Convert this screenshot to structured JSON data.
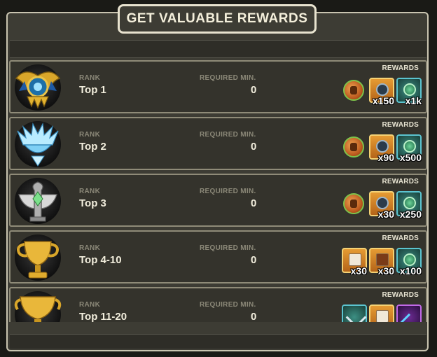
{
  "title": "GET VALUABLE REWARDS",
  "labels": {
    "rank": "RANK",
    "required": "REQUIRED MIN.",
    "rewards": "REWARDS"
  },
  "rows": [
    {
      "rank": "Top 1",
      "required": "0",
      "emblem": "blue-gold-crest-icon",
      "rewards": [
        {
          "icon": "medal-icon",
          "count": ""
        },
        {
          "icon": "chest-icon",
          "count": "x150"
        },
        {
          "icon": "coin-icon",
          "count": "x1k"
        }
      ]
    },
    {
      "rank": "Top 2",
      "required": "0",
      "emblem": "ice-crest-icon",
      "rewards": [
        {
          "icon": "medal-icon",
          "count": ""
        },
        {
          "icon": "chest-icon",
          "count": "x90"
        },
        {
          "icon": "coin-icon",
          "count": "x500"
        }
      ]
    },
    {
      "rank": "Top 3",
      "required": "0",
      "emblem": "silver-serpent-crest-icon",
      "rewards": [
        {
          "icon": "medal-icon",
          "count": ""
        },
        {
          "icon": "chest-icon",
          "count": "x30"
        },
        {
          "icon": "coin-icon",
          "count": "x250"
        }
      ]
    },
    {
      "rank": "Top 4-10",
      "required": "0",
      "emblem": "gold-trophy-icon",
      "rewards": [
        {
          "icon": "scroll-box-icon",
          "count": "x30"
        },
        {
          "icon": "warrior-card-icon",
          "count": "x30"
        },
        {
          "icon": "coin-icon",
          "count": "x100"
        }
      ]
    },
    {
      "rank": "Top 11-20",
      "required": "0",
      "emblem": "gold-cup-icon",
      "rewards": [
        {
          "icon": "anchor-icon",
          "count": ""
        },
        {
          "icon": "scroll-box-icon",
          "count": ""
        },
        {
          "icon": "key-icon",
          "count": ""
        }
      ]
    }
  ]
}
